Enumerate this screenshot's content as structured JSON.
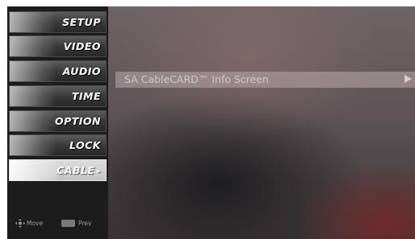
{
  "menu": {
    "items": [
      {
        "label": "SETUP",
        "selected": false
      },
      {
        "label": "VIDEO",
        "selected": false
      },
      {
        "label": "AUDIO",
        "selected": false
      },
      {
        "label": "TIME",
        "selected": false
      },
      {
        "label": "OPTION",
        "selected": false
      },
      {
        "label": "LOCK",
        "selected": false
      },
      {
        "label": "CABLE",
        "selected": true
      }
    ],
    "selected_arrow": "▸"
  },
  "nav_hint": {
    "move_label": "Move",
    "prev_label": "Prev"
  },
  "submenu": {
    "item_label": "SA CableCARD™ Info Screen"
  },
  "colors": {
    "menu_bg": "#1c1c1c",
    "selected_item": "#d0d0d0"
  }
}
